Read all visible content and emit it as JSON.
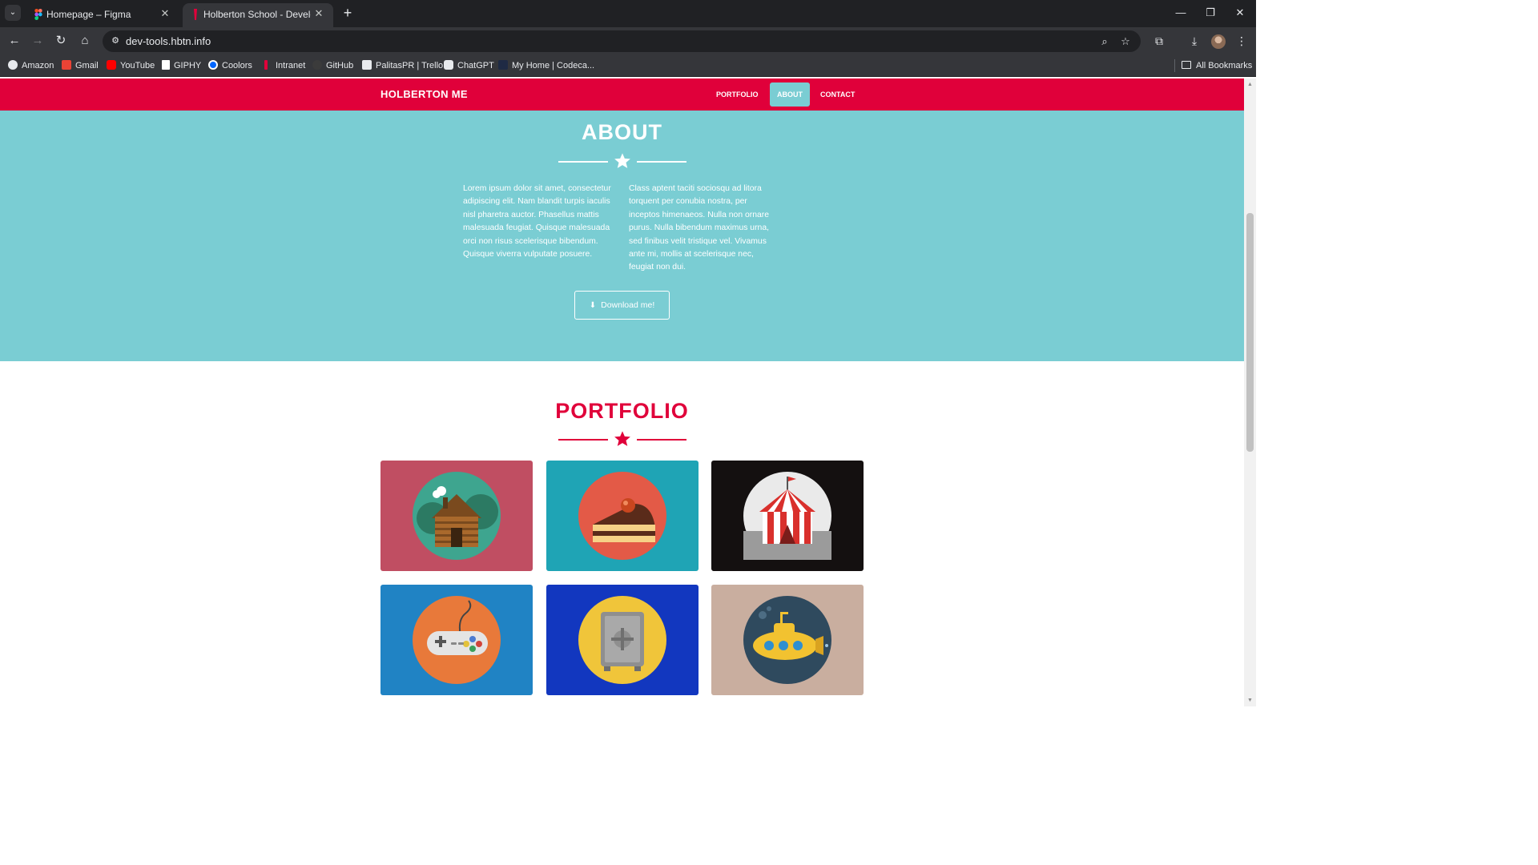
{
  "browser": {
    "tabs": [
      {
        "title": "Homepage – Figma",
        "active": false,
        "favicon": "figma-icon"
      },
      {
        "title": "Holberton School - Developer t",
        "active": true,
        "favicon": "holberton-icon"
      }
    ],
    "new_tab_label": "+",
    "window_controls": {
      "minimize": "—",
      "restore": "❐",
      "close": "✕"
    },
    "url": "dev-tools.hbtn.info",
    "bookmarks": [
      {
        "label": "Amazon",
        "icon": "amazon-icon",
        "color": "#ffffff"
      },
      {
        "label": "Gmail",
        "icon": "gmail-icon",
        "color": "#ea4335"
      },
      {
        "label": "YouTube",
        "icon": "youtube-icon",
        "color": "#ff0000"
      },
      {
        "label": "GIPHY",
        "icon": "giphy-icon",
        "color": "#ffffff"
      },
      {
        "label": "Coolors",
        "icon": "coolors-icon",
        "color": "#0066ff"
      },
      {
        "label": "Intranet",
        "icon": "holberton-icon",
        "color": "#e0003a"
      },
      {
        "label": "GitHub",
        "icon": "github-icon",
        "color": "#3b3b3b"
      },
      {
        "label": "PalitasPR | Trello",
        "icon": "trello-icon",
        "color": "#0079bf"
      },
      {
        "label": "ChatGPT",
        "icon": "chatgpt-icon",
        "color": "#ffffff"
      },
      {
        "label": "My Home | Codeca...",
        "icon": "codecademy-icon",
        "color": "#1f2a44"
      }
    ],
    "all_bookmarks_label": "All Bookmarks"
  },
  "site": {
    "brand": "HOLBERTON ME",
    "nav": [
      {
        "label": "PORTFOLIO",
        "active": false
      },
      {
        "label": "ABOUT",
        "active": true
      },
      {
        "label": "CONTACT",
        "active": false
      }
    ],
    "about": {
      "title": "ABOUT",
      "col1": "Lorem ipsum dolor sit amet, consectetur adipiscing elit. Nam blandit turpis iaculis nisl pharetra auctor. Phasellus mattis malesuada feugiat. Quisque malesuada orci non risus scelerisque bibendum. Quisque viverra vulputate posuere.",
      "col2": "Class aptent taciti sociosqu ad litora torquent per conubia nostra, per inceptos himenaeos. Nulla non ornare purus. Nulla bibendum maximus urna, sed finibus velit tristique vel. Vivamus ante mi, mollis at scelerisque nec, feugiat non dui.",
      "download_label": "Download me!"
    },
    "portfolio": {
      "title": "PORTFOLIO",
      "items": [
        {
          "name": "cabin",
          "background": "#c04e62"
        },
        {
          "name": "cake",
          "background": "#1fa4b5"
        },
        {
          "name": "circus",
          "background": "#141010"
        },
        {
          "name": "game",
          "background": "#2083c4"
        },
        {
          "name": "safe",
          "background": "#1237bf"
        },
        {
          "name": "submarine",
          "background": "#c9ae9f"
        }
      ]
    }
  },
  "colors": {
    "accent_red": "#e0003a",
    "accent_teal": "#7acdd3"
  }
}
